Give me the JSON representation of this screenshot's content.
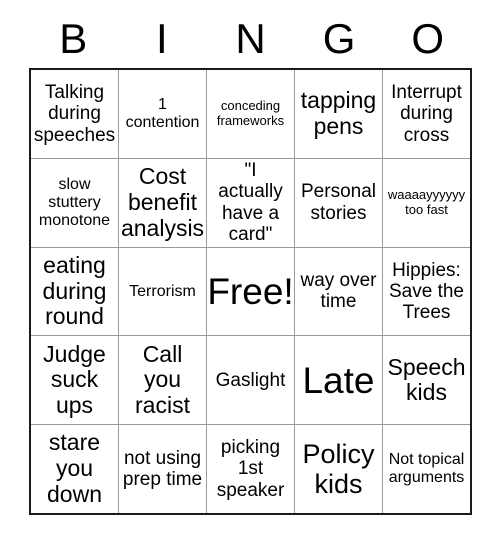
{
  "card": {
    "header_letters": [
      "B",
      "I",
      "N",
      "G",
      "O"
    ],
    "cells": [
      {
        "text": "Talking during speeches",
        "size": "md"
      },
      {
        "text": "1 contention",
        "size": "sm"
      },
      {
        "text": "conceding frameworks",
        "size": "xs"
      },
      {
        "text": "tapping pens",
        "size": "lg"
      },
      {
        "text": "Interrupt during cross",
        "size": "md"
      },
      {
        "text": "slow stuttery monotone",
        "size": "sm"
      },
      {
        "text": "Cost benefit analysis",
        "size": "lg"
      },
      {
        "text": "\"I actually have a card\"",
        "size": "md"
      },
      {
        "text": "Personal stories",
        "size": "md"
      },
      {
        "text": "waaaayyyyyy too fast",
        "size": "xs"
      },
      {
        "text": "eating during round",
        "size": "lg"
      },
      {
        "text": "Terrorism",
        "size": "sm"
      },
      {
        "text": "Free!",
        "size": "xxl"
      },
      {
        "text": "way over time",
        "size": "md"
      },
      {
        "text": "Hippies: Save the Trees",
        "size": "md"
      },
      {
        "text": "Judge suck ups",
        "size": "lg"
      },
      {
        "text": "Call you racist",
        "size": "lg"
      },
      {
        "text": "Gaslight",
        "size": "md"
      },
      {
        "text": "Late",
        "size": "xxl"
      },
      {
        "text": "Speech kids",
        "size": "lg"
      },
      {
        "text": "stare you down",
        "size": "lg"
      },
      {
        "text": "not using prep time",
        "size": "md"
      },
      {
        "text": "picking 1st speaker",
        "size": "md"
      },
      {
        "text": "Policy kids",
        "size": "xl"
      },
      {
        "text": "Not topical arguments",
        "size": "sm"
      }
    ]
  }
}
